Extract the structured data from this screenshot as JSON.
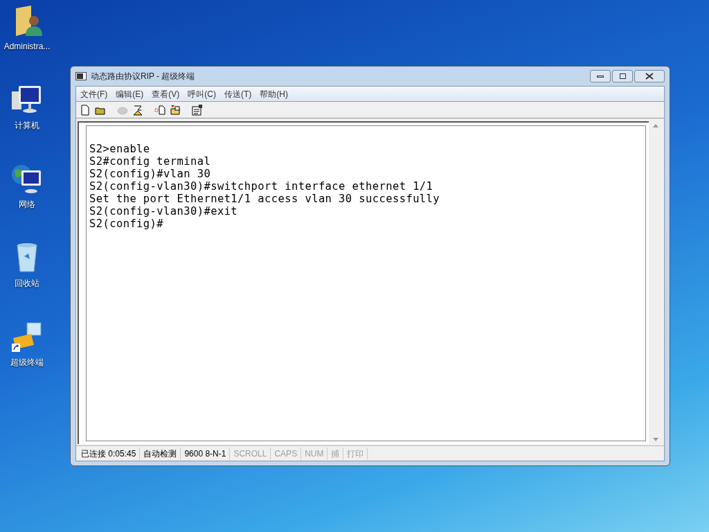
{
  "desktop_icons": [
    {
      "kind": "user-folder",
      "label": "Administra..."
    },
    {
      "kind": "computer",
      "label": "计算机"
    },
    {
      "kind": "network",
      "label": "网络"
    },
    {
      "kind": "recycle",
      "label": "回收站"
    },
    {
      "kind": "terminal",
      "label": "超级终端"
    }
  ],
  "window": {
    "title": "动态路由协议RIP - 超级终端"
  },
  "menu": [
    "文件(F)",
    "编辑(E)",
    "查看(V)",
    "呼叫(C)",
    "传送(T)",
    "帮助(H)"
  ],
  "toolbar": [
    {
      "kind": "new",
      "disabled": false
    },
    {
      "kind": "open",
      "disabled": false
    },
    {
      "kind": "call",
      "disabled": true
    },
    {
      "kind": "hangup",
      "disabled": false
    },
    {
      "kind": "send",
      "disabled": false
    },
    {
      "kind": "receive",
      "disabled": false
    },
    {
      "kind": "properties",
      "disabled": false
    }
  ],
  "terminal_lines": [
    "S2>enable",
    "S2#config terminal",
    "S2(config)#vlan 30",
    "S2(config-vlan30)#switchport interface ethernet 1/1",
    "Set the port Ethernet1/1 access vlan 30 successfully",
    "S2(config-vlan30)#exit",
    "S2(config)#"
  ],
  "status_bar": [
    {
      "text": "已连接 0:05:45",
      "active": true
    },
    {
      "text": "自动检测",
      "active": true
    },
    {
      "text": "9600 8-N-1",
      "active": true
    },
    {
      "text": "SCROLL",
      "active": false
    },
    {
      "text": "CAPS",
      "active": false
    },
    {
      "text": "NUM",
      "active": false
    },
    {
      "text": "捕",
      "active": false
    },
    {
      "text": "打印",
      "active": false
    }
  ]
}
